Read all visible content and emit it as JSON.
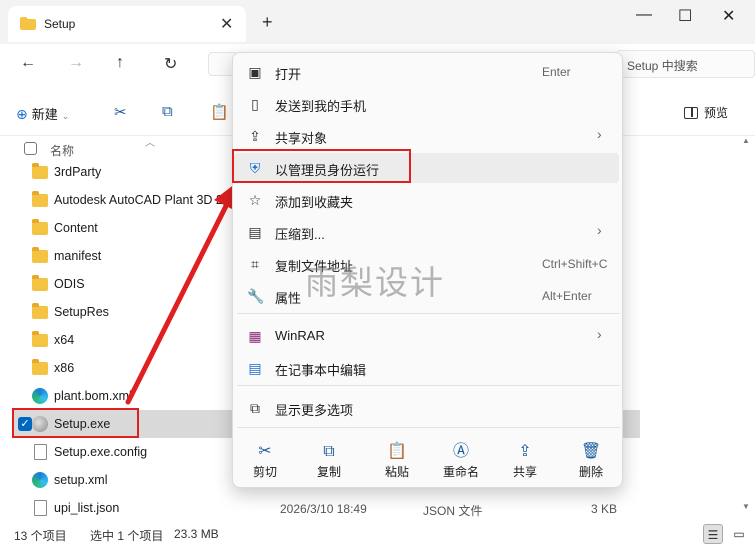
{
  "window": {
    "tab_title": "Setup",
    "new_tab": "+",
    "min": "—",
    "max": "☐",
    "close": "✕"
  },
  "address": {
    "search_placeholder": "Setup 中搜索"
  },
  "toolbar": {
    "new_label": "新建",
    "preview_label": "预览"
  },
  "columns": {
    "name": "名称"
  },
  "files": [
    {
      "name": "3rdParty",
      "type": "folder"
    },
    {
      "name": "Autodesk AutoCAD Plant 3D 20",
      "type": "folder"
    },
    {
      "name": "Content",
      "type": "folder"
    },
    {
      "name": "manifest",
      "type": "folder"
    },
    {
      "name": "ODIS",
      "type": "folder"
    },
    {
      "name": "SetupRes",
      "type": "folder"
    },
    {
      "name": "x64",
      "type": "folder"
    },
    {
      "name": "x86",
      "type": "folder"
    },
    {
      "name": "plant.bom.xml",
      "type": "edge"
    },
    {
      "name": "Setup.exe",
      "type": "exe"
    },
    {
      "name": "Setup.exe.config",
      "type": "doc"
    },
    {
      "name": "setup.xml",
      "type": "edge"
    },
    {
      "name": "upi_list.json",
      "type": "doc"
    }
  ],
  "last_row_details": {
    "date": "2026/3/10 18:49",
    "type": "JSON 文件",
    "size": "3 KB"
  },
  "status": {
    "count": "13 个项目",
    "selected": "选中 1 个项目",
    "size": "23.3 MB"
  },
  "context_menu": {
    "items": [
      {
        "label": "打开",
        "shortcut": "Enter",
        "icon": "open-icon"
      },
      {
        "label": "发送到我的手机",
        "shortcut": "",
        "icon": "phone-icon"
      },
      {
        "label": "共享对象",
        "shortcut": "",
        "icon": "share-icon",
        "submenu": true
      },
      {
        "label": "以管理员身份运行",
        "shortcut": "",
        "icon": "shield-icon"
      },
      {
        "label": "添加到收藏夹",
        "shortcut": "",
        "icon": "star-icon"
      },
      {
        "label": "压缩到...",
        "shortcut": "",
        "icon": "zip-icon",
        "submenu": true
      },
      {
        "label": "复制文件地址",
        "shortcut": "Ctrl+Shift+C",
        "icon": "copy-path-icon"
      },
      {
        "label": "属性",
        "shortcut": "Alt+Enter",
        "icon": "wrench-icon"
      },
      {
        "label": "WinRAR",
        "shortcut": "",
        "icon": "winrar-icon",
        "submenu": true
      },
      {
        "label": "在记事本中编辑",
        "shortcut": "",
        "icon": "notepad-icon"
      },
      {
        "label": "显示更多选项",
        "shortcut": "",
        "icon": "more-options-icon"
      }
    ],
    "quick_actions": [
      {
        "label": "剪切",
        "icon": "cut-icon"
      },
      {
        "label": "复制",
        "icon": "copy-icon"
      },
      {
        "label": "粘贴",
        "icon": "paste-icon"
      },
      {
        "label": "重命名",
        "icon": "rename-icon"
      },
      {
        "label": "共享",
        "icon": "share-icon"
      },
      {
        "label": "删除",
        "icon": "delete-icon"
      }
    ]
  },
  "watermark": "雨梨设计",
  "colors": {
    "highlight_red": "#e02020",
    "selection_blue": "#0067c0",
    "folder_yellow": "#f4c344"
  }
}
